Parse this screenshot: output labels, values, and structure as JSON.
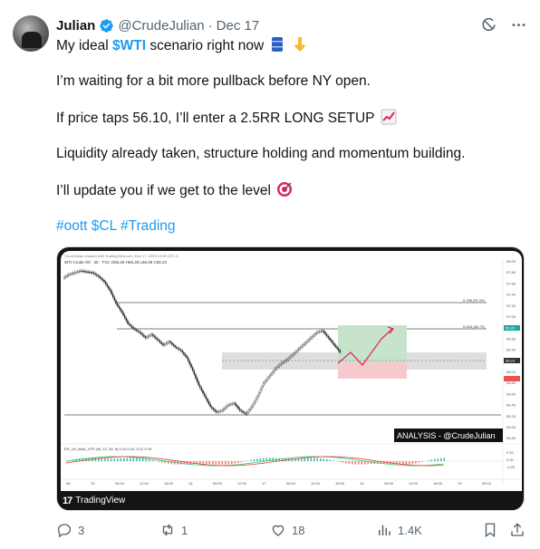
{
  "tweet": {
    "author_name": "Julian",
    "handle": "@CrudeJulian",
    "separator": "·",
    "date": "Dec 17",
    "lines": {
      "l1_prefix": "My ideal",
      "l1_cashtag": "$WTI",
      "l1_suffix": "scenario right now",
      "l2": "I’m waiting for a bit more pullback before NY open.",
      "l3": "If price taps 56.10, I’ll enter a 2.5RR LONG SETUP",
      "l4": "Liquidity already taken, structure holding and momentum building.",
      "l5": "I’ll update you if we get to the level",
      "hashtags": "#oott $CL #Trading"
    }
  },
  "media": {
    "top_caption": "CrudeJulian created with TradingView.com, Dec 17, 2025 13:25 UTC-5",
    "symbol_line": "WTI Crude Oil · 30 · TVC  O56.20  H56.28  L56.09  C56.23",
    "fib_upper": "0.786 (57.20)",
    "fib_lower": "0.618 (56.73)",
    "analysis_label": "ANALYSIS - @CrudeJulian",
    "indicator_line": "ER_Uh_MaD_XTF (40, 12, 26, 9)  0.10  0.19  -0.21  0.19",
    "brand": "TradingView",
    "price_axis": [
      "58.00",
      "57.80",
      "57.60",
      "57.40",
      "57.20",
      "57.00",
      "56.80",
      "56.60",
      "56.40",
      "56.20",
      "56.00",
      "55.80",
      "55.60",
      "55.40",
      "55.20",
      "55.00",
      "54.80"
    ],
    "current_price": "56.29",
    "current_price_2": "56.23",
    "time_axis": [
      "08",
      "15",
      "06:00",
      "12:00",
      "18:00",
      "16",
      "06:00",
      "12:00",
      "17",
      "06:00",
      "12:00",
      "18:00",
      "18",
      "06:00",
      "12:00",
      "18:00",
      "19",
      "06:00"
    ],
    "indicator_axis": [
      "0.20",
      "0.00",
      "-0.20"
    ]
  },
  "actions": {
    "replies": "3",
    "reposts": "1",
    "likes": "18",
    "views": "1.4K"
  },
  "colors": {
    "link": "#1d9bf0",
    "muted": "#536471",
    "target_zone": "#c7e3cc",
    "stop_zone": "#f7c9cf"
  }
}
